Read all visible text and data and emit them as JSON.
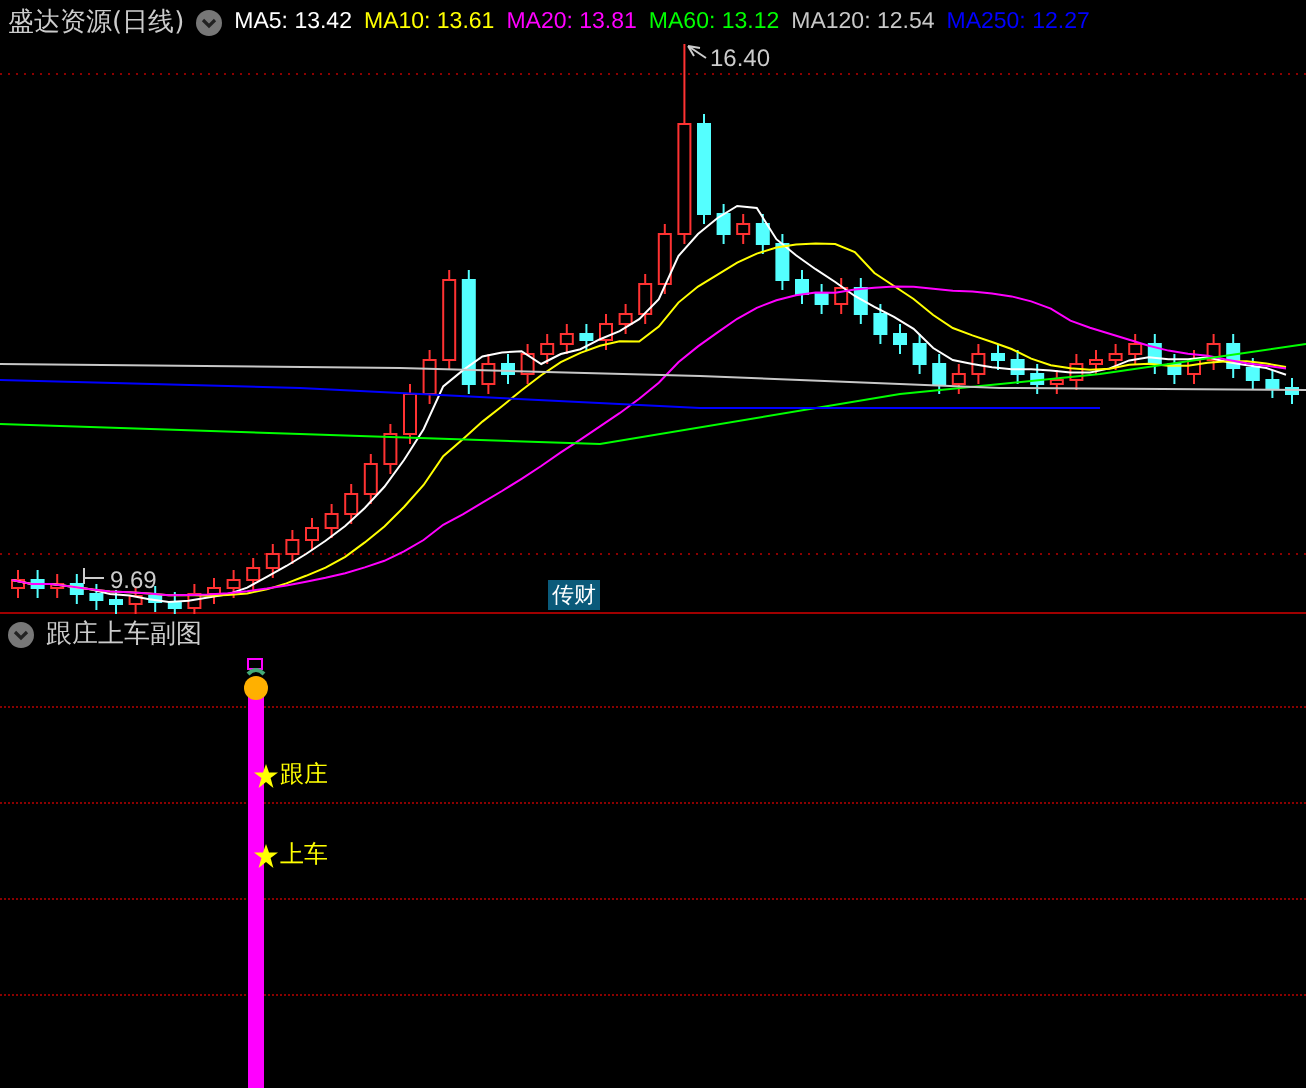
{
  "main_panel": {
    "title": "盛达资源(日线)",
    "moving_averages": [
      {
        "label": "MA5:",
        "value": "13.42",
        "color": "#ffffff"
      },
      {
        "label": "MA10:",
        "value": "13.61",
        "color": "#ffff00"
      },
      {
        "label": "MA20:",
        "value": "13.81",
        "color": "#ff00ff"
      },
      {
        "label": "MA60:",
        "value": "13.12",
        "color": "#00ff00"
      },
      {
        "label": "MA120:",
        "value": "12.54",
        "color": "#c8c8c8"
      },
      {
        "label": "MA250:",
        "value": "12.27",
        "color": "#0000ff"
      }
    ],
    "high_label": "16.40",
    "low_label": "9.69",
    "badge": "传财"
  },
  "sub_panel": {
    "title": "跟庄上车副图",
    "signals": [
      {
        "label": "跟庄"
      },
      {
        "label": "上车"
      }
    ]
  }
}
